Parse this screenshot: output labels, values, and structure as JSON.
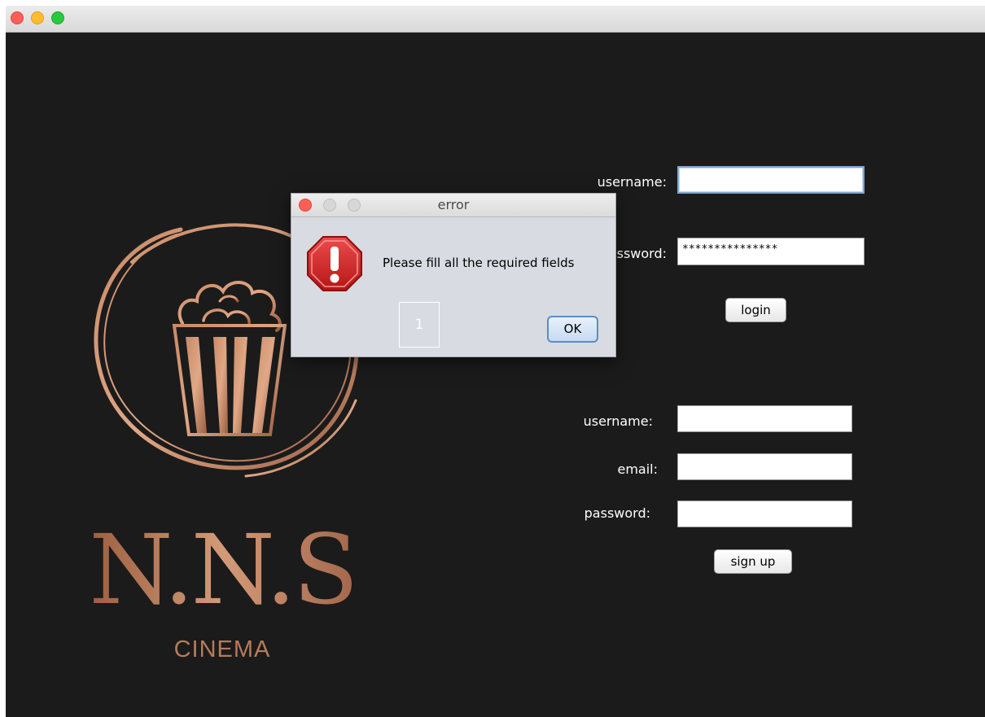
{
  "brand": {
    "title": "N.N.S",
    "subtitle": "CINEMA",
    "emblem_icon": "popcorn-bucket-icon",
    "accent_color": "#b77a5b"
  },
  "login": {
    "username_label": "username:",
    "username_value": "",
    "password_label": "password:",
    "password_value": "***************",
    "button_label": "login"
  },
  "signup": {
    "username_label": "username:",
    "username_value": "",
    "email_label": "email:",
    "email_value": "",
    "password_label": "password:",
    "password_value": "",
    "button_label": "sign up"
  },
  "dialog": {
    "title": "error",
    "icon": "error-stop-icon",
    "message": "Please fill all the required fields",
    "badge": "1",
    "ok_label": "OK"
  }
}
